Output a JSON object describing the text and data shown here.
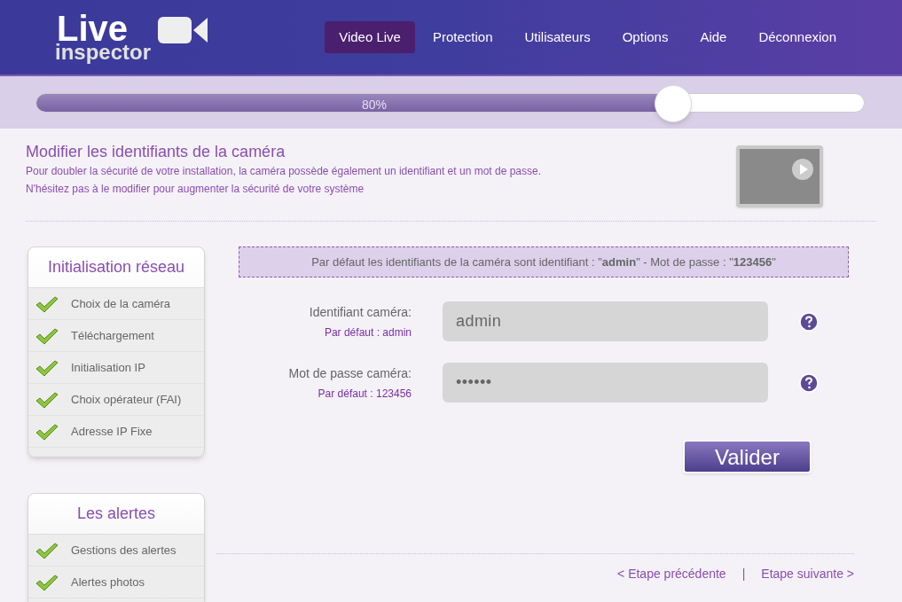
{
  "logo": {
    "line_1": "Live",
    "line_2": "inspector"
  },
  "nav": [
    {
      "label": "Video Live",
      "selected": true
    },
    {
      "label": "Protection",
      "selected": false
    },
    {
      "label": "Utilisateurs",
      "selected": false
    },
    {
      "label": "Options",
      "selected": false
    },
    {
      "label": "Aide",
      "selected": false
    },
    {
      "label": "Déconnexion",
      "selected": false
    }
  ],
  "progress": {
    "label": "80%",
    "level": 0.77
  },
  "intro": {
    "title": "Modifier les identifiants de la caméra",
    "lines": [
      "Pour doubler la sécurité de votre installation, la caméra possède également un identifiant et un mot de passe.",
      "N'hésitez pas à le modifier pour augmenter la sécurité de votre système"
    ]
  },
  "sidebar": [
    {
      "title": "Initialisation réseau",
      "items": [
        {
          "label": "Choix de la caméra",
          "done": true
        },
        {
          "label": "Téléchargement",
          "done": true
        },
        {
          "label": "Initialisation IP",
          "done": true
        },
        {
          "label": "Choix opérateur (FAI)",
          "done": true
        },
        {
          "label": "Adresse IP Fixe",
          "done": true
        }
      ]
    },
    {
      "title": "Les alertes",
      "items": [
        {
          "label": "Gestions des alertes",
          "done": true
        },
        {
          "label": "Alertes photos",
          "done": true
        }
      ]
    }
  ],
  "notice": "Par défaut les identifiants de la caméra sont identifiant : \"**admin**\" - Mot de passe : \"**123456**\"",
  "fields": [
    {
      "label": "Identifiant caméra:",
      "hint": "Par défaut : admin",
      "value": "admin"
    },
    {
      "label": "Mot de passe caméra:",
      "hint": "Par défaut : 123456",
      "value": "••••••"
    }
  ],
  "submit": "Valider",
  "footer": {
    "previous": "< Etape précédente",
    "separator": "|",
    "next": "Etape suivante >"
  }
}
